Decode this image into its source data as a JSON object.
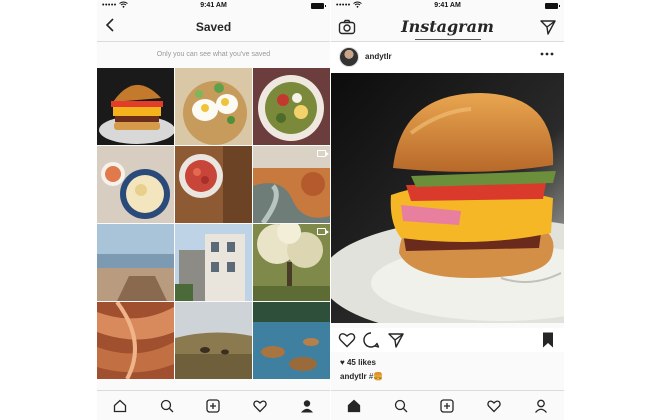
{
  "left_screen": {
    "status": {
      "time": "9:41 AM",
      "signal": "•••••"
    },
    "title": "Saved",
    "hint": "Only you can see what you've saved",
    "grid": [
      {
        "subject": "burger",
        "video": false
      },
      {
        "subject": "poached eggs",
        "video": false
      },
      {
        "subject": "salad bowl",
        "video": false
      },
      {
        "subject": "soup bowl",
        "video": false
      },
      {
        "subject": "strawberries",
        "video": false
      },
      {
        "subject": "river valley",
        "video": true
      },
      {
        "subject": "beach cliffs",
        "video": false
      },
      {
        "subject": "victorian houses",
        "video": false
      },
      {
        "subject": "blossom tree",
        "video": true
      },
      {
        "subject": "sandstone canyon",
        "video": false
      },
      {
        "subject": "meadow bison",
        "video": false
      },
      {
        "subject": "lake rocks",
        "video": false
      }
    ]
  },
  "right_screen": {
    "status": {
      "time": "9:41 AM",
      "signal": "•••••"
    },
    "logo": "Instagram",
    "post": {
      "username": "andytlr",
      "likes": "♥ 45 likes",
      "caption_user": "andytlr",
      "caption_text": " #🍔"
    }
  },
  "icons": {
    "back": "chevron-left-icon",
    "camera": "camera-icon",
    "direct": "paper-plane-icon",
    "more": "ellipsis-icon",
    "like": "heart-icon",
    "comment": "speech-bubble-icon",
    "share": "paper-plane-icon",
    "save": "bookmark-filled-icon",
    "tabs": [
      "home-icon",
      "search-icon",
      "add-post-icon",
      "activity-heart-icon",
      "profile-icon"
    ]
  },
  "colors": {
    "bar": "#fafafa",
    "text": "#262626",
    "muted": "#999999",
    "divider": "#dbdbdb"
  }
}
